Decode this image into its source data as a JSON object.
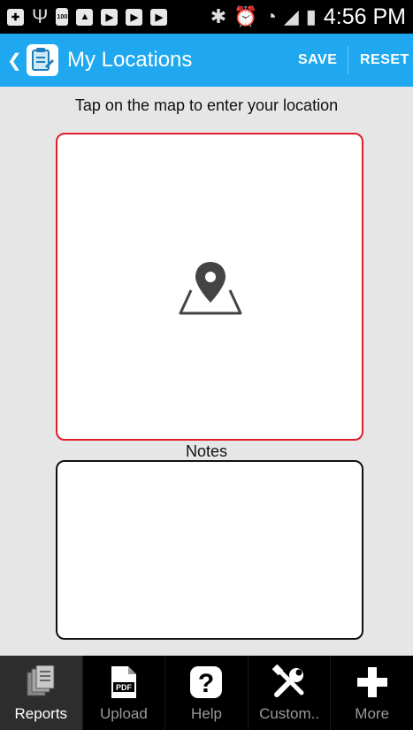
{
  "status_bar": {
    "time": "4:56 PM",
    "battery_badge": "100"
  },
  "action_bar": {
    "title": "My Locations",
    "save_label": "SAVE",
    "reset_label": "RESET"
  },
  "main": {
    "instruction": "Tap on the map to enter your location",
    "notes_label": "Notes",
    "map_border_color": "#e0202a"
  },
  "tabs": [
    {
      "label": "Reports",
      "icon": "reports-icon",
      "active": true
    },
    {
      "label": "Upload",
      "icon": "pdf-icon",
      "active": false
    },
    {
      "label": "Help",
      "icon": "help-icon",
      "active": false
    },
    {
      "label": "Custom..",
      "icon": "tools-icon",
      "active": false
    },
    {
      "label": "More",
      "icon": "plus-icon",
      "active": false
    }
  ],
  "colors": {
    "accent": "#1fa8ef",
    "background": "#e6e6e6"
  }
}
